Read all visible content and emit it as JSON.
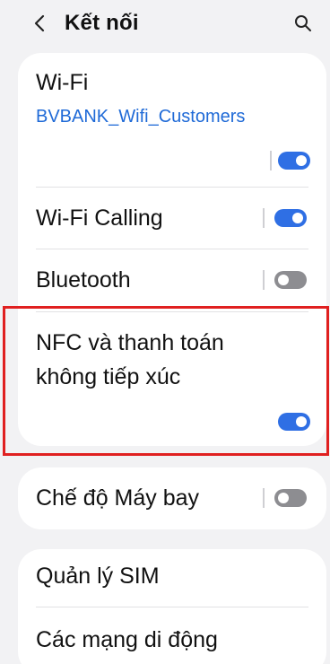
{
  "header": {
    "title": "Kết nối",
    "back_icon": "chevron-left-icon",
    "search_icon": "search-icon"
  },
  "connections": {
    "wifi": {
      "label": "Wi-Fi",
      "network": "BVBANK_Wifi_Customers",
      "enabled": true
    },
    "wifi_calling": {
      "label": "Wi-Fi Calling",
      "enabled": true
    },
    "bluetooth": {
      "label": "Bluetooth",
      "enabled": false
    },
    "nfc": {
      "label_line1": "NFC và thanh toán",
      "label_line2": "không tiếp xúc",
      "enabled": true
    }
  },
  "airplane": {
    "label": "Chế độ Máy bay",
    "enabled": false
  },
  "sim": {
    "sim_manager_label": "Quản lý SIM",
    "mobile_networks_label": "Các mạng di động"
  },
  "colors": {
    "toggle_on": "#2f6fe4",
    "toggle_off": "#8d8d91",
    "link_blue": "#1f6ad7",
    "highlight_red": "#e02020",
    "background": "#f2f2f4"
  }
}
